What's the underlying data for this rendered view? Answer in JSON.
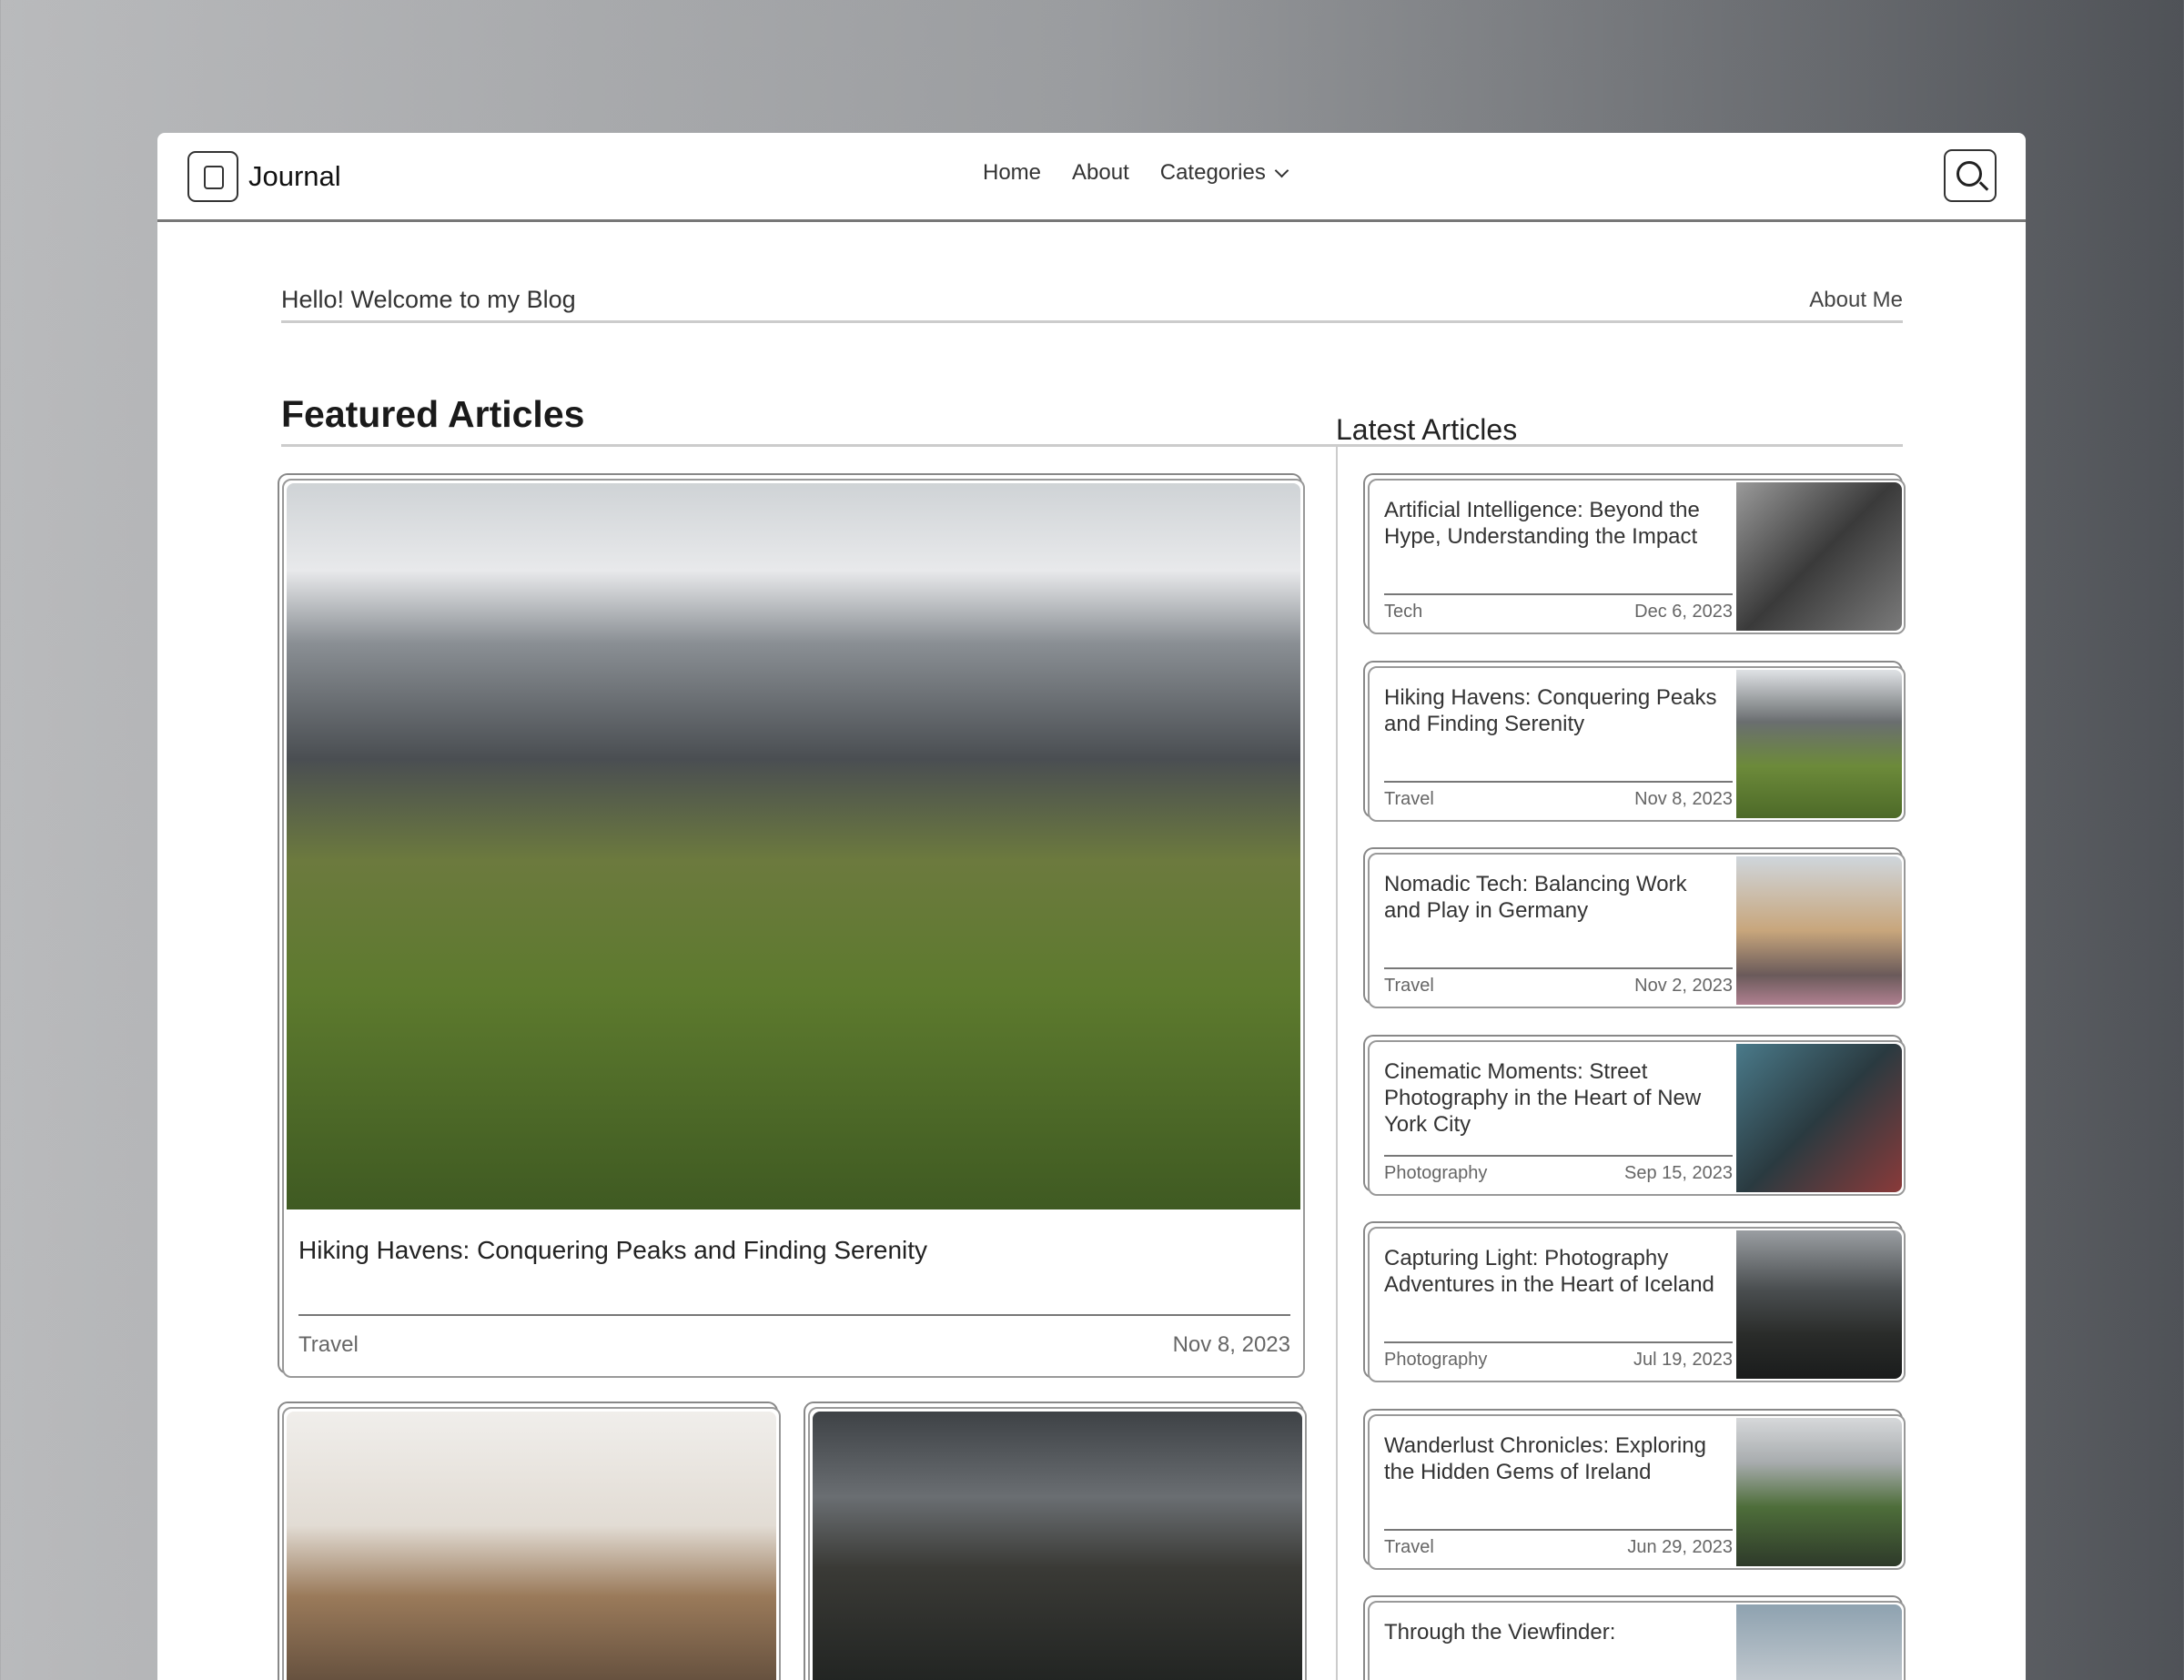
{
  "header": {
    "brand": "Journal",
    "nav": [
      "Home",
      "About",
      "Categories"
    ]
  },
  "intro": {
    "greeting": "Hello! Welcome to my Blog",
    "about_link": "About Me"
  },
  "featured": {
    "heading": "Featured Articles",
    "main": {
      "title": "Hiking Havens: Conquering Peaks and Finding Serenity",
      "category": "Travel",
      "date": "Nov 8, 2023"
    }
  },
  "latest": {
    "heading": "Latest Articles",
    "items": [
      {
        "title": "Artificial Intelligence: Beyond the Hype, Understanding the Impact",
        "category": "Tech",
        "date": "Dec 6, 2023",
        "thumb": "linear-gradient(135deg,#9a9a9a,#3a3a3a 50%,#7a7a7a)"
      },
      {
        "title": "Hiking Havens: Conquering Peaks and Finding Serenity",
        "category": "Travel",
        "date": "Nov 8, 2023",
        "thumb": "linear-gradient(180deg,#dfe2e5,#6a6e70 35%,#6c8a3a 65%,#4d6a28)"
      },
      {
        "title": "Nomadic Tech: Balancing Work and Play in Germany",
        "category": "Travel",
        "date": "Nov 2, 2023",
        "thumb": "linear-gradient(180deg,#cfd6dc,#c8a67c 50%,#6a5a5a 80%,#b08090)"
      },
      {
        "title": "Cinematic Moments: Street Photography in the Heart of New York City",
        "category": "Photography",
        "date": "Sep 15, 2023",
        "thumb": "linear-gradient(135deg,#4a7a8a,#2a3a40 50%,#8a3a3a)"
      },
      {
        "title": "Capturing Light: Photography Adventures in the Heart of Iceland",
        "category": "Photography",
        "date": "Jul 19, 2023",
        "thumb": "linear-gradient(180deg,#9a9ea2,#4a4e50 40%,#2a2c2a 70%,#1a1c1c)"
      },
      {
        "title": "Wanderlust Chronicles: Exploring the Hidden Gems of Ireland",
        "category": "Travel",
        "date": "Jun 29, 2023",
        "thumb": "linear-gradient(180deg,#d6d8da,#a8acae 30%,#4e6e3a 60%,#2e3a2a)"
      },
      {
        "title": "Through the Viewfinder:",
        "category": "",
        "date": "",
        "thumb": "linear-gradient(180deg,#8ea2b0,#c8cdd2 60%,#444)"
      }
    ]
  }
}
